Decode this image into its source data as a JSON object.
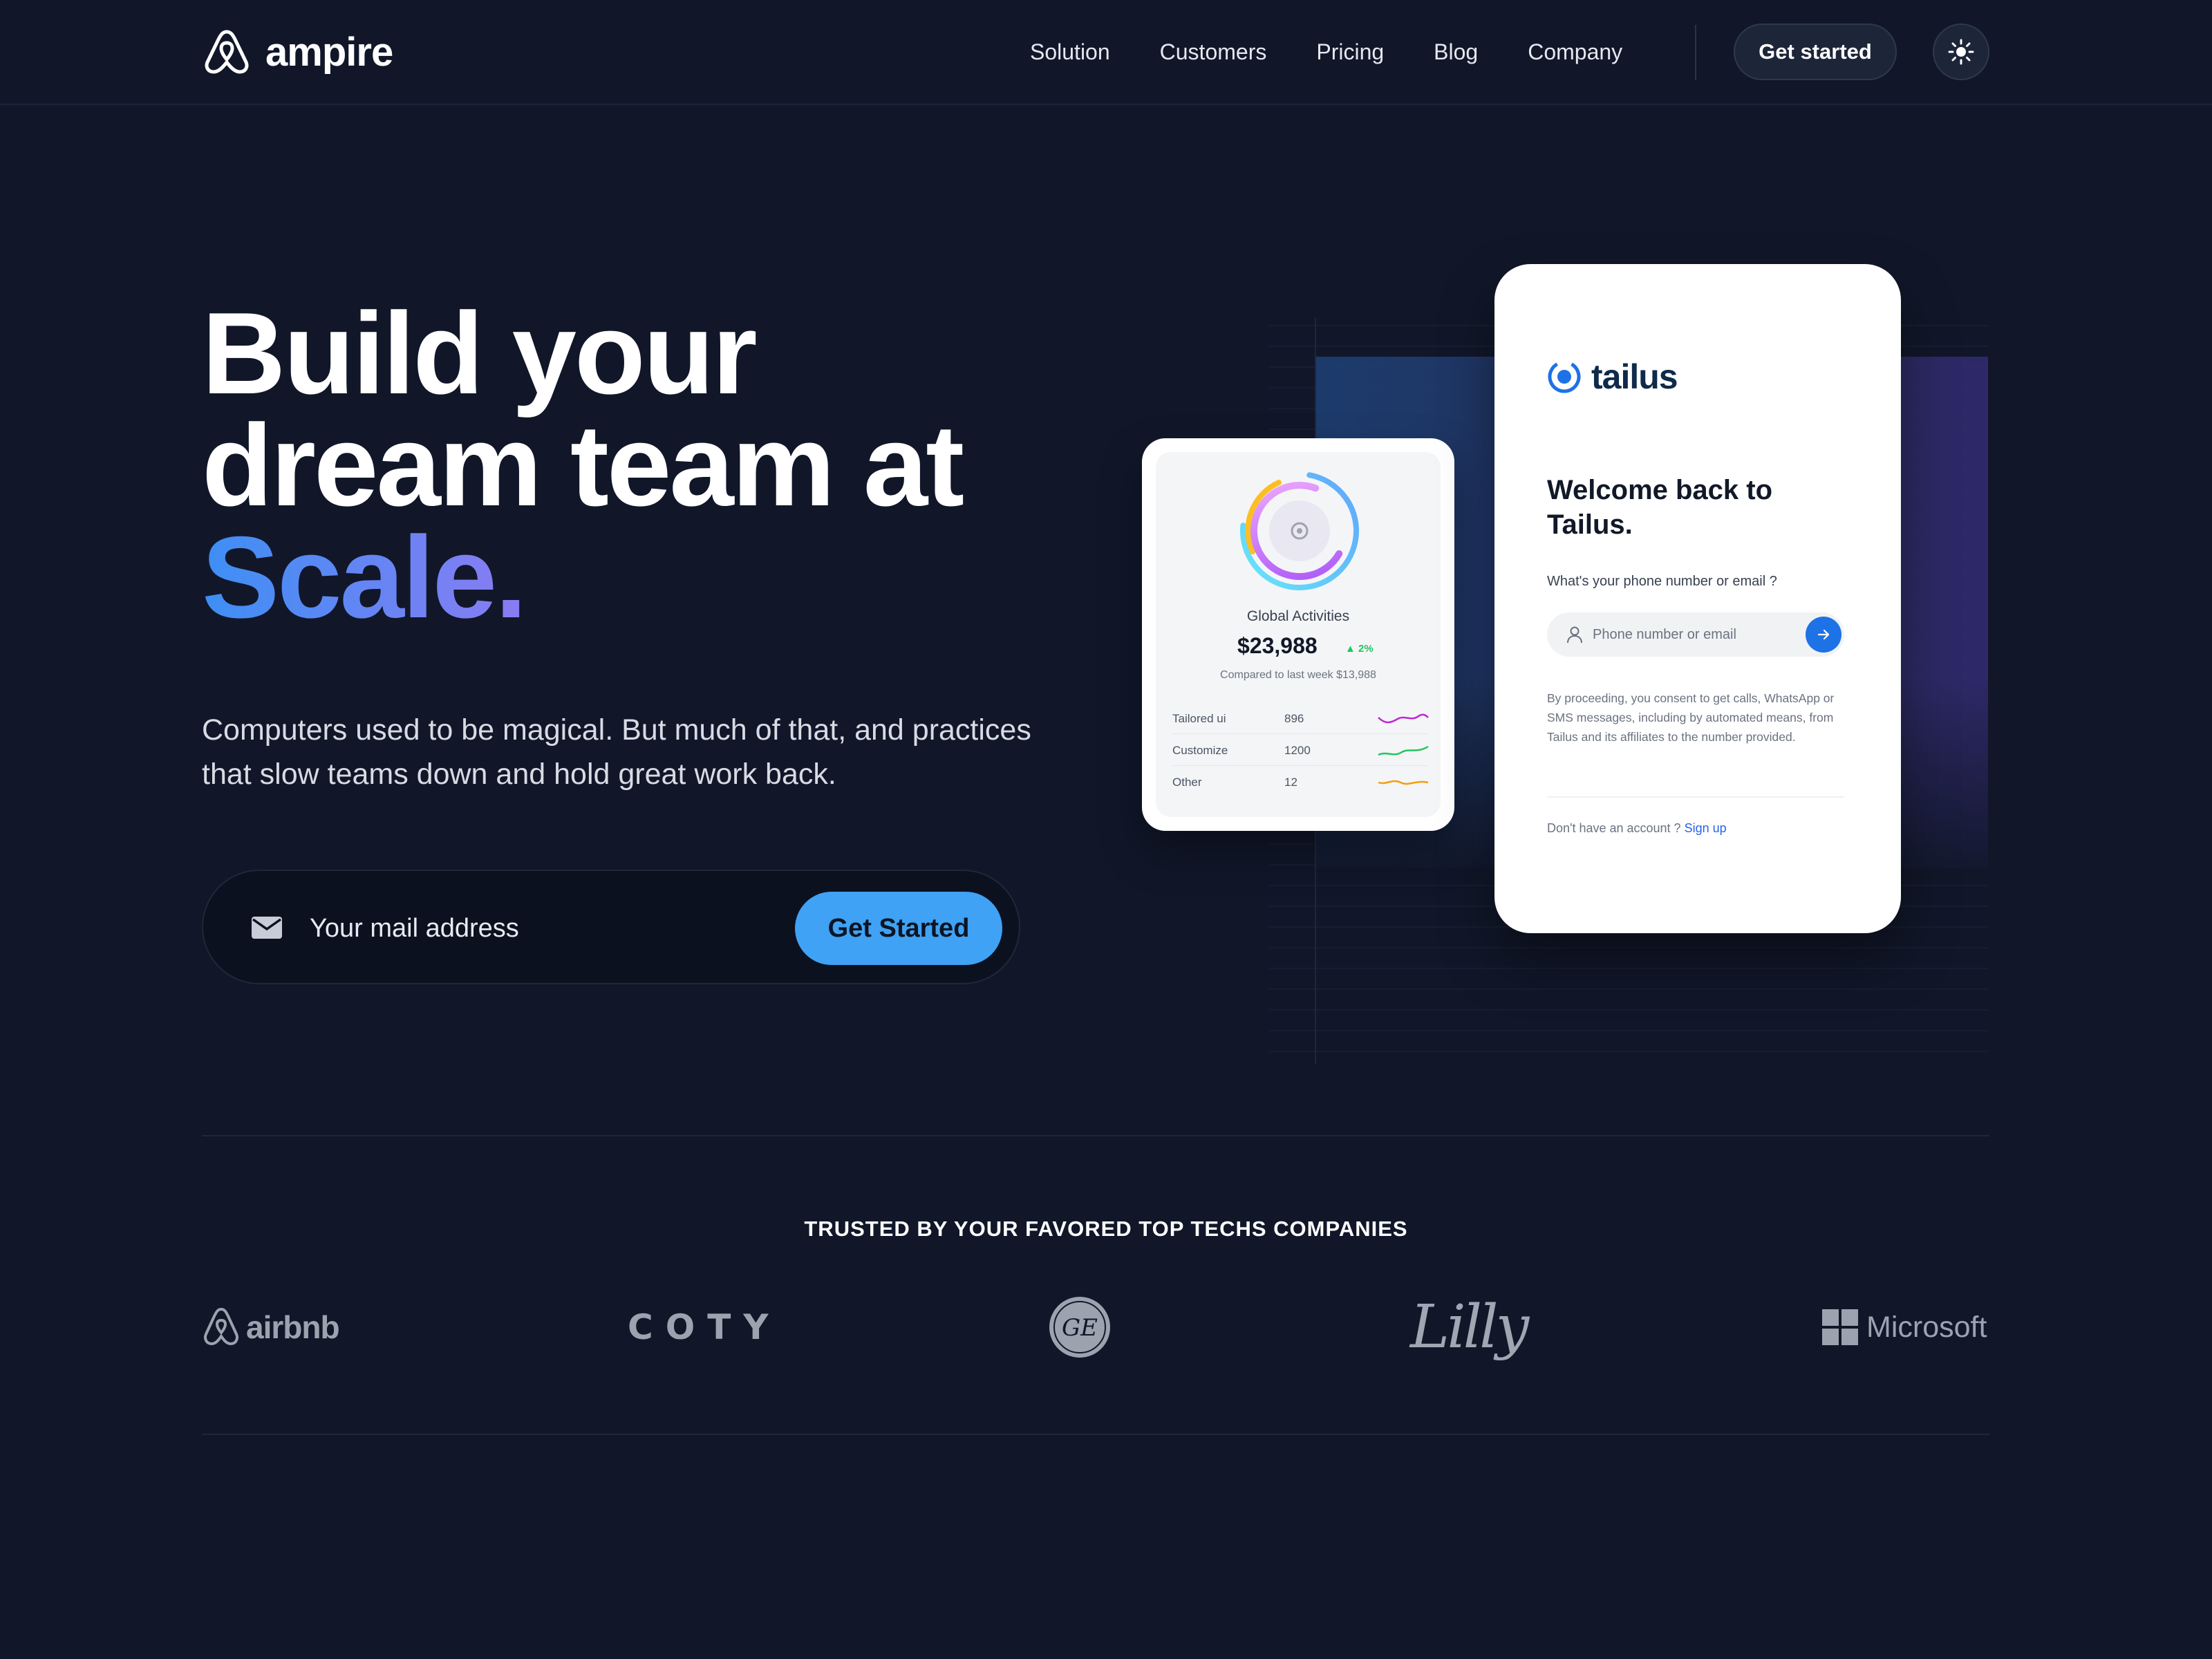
{
  "nav": {
    "brand": "ampire",
    "links": [
      "Solution",
      "Customers",
      "Pricing",
      "Blog",
      "Company"
    ],
    "cta": "Get started"
  },
  "hero": {
    "headline_line1": "Build your",
    "headline_line2": "dream team at",
    "headline_highlight": "Scale.",
    "subtitle": "Computers used to be magical. But much of that, and practices that slow teams down and hold great work back.",
    "email_placeholder": "Your mail address",
    "submit": "Get Started"
  },
  "stats_card": {
    "title": "Global Activities",
    "amount": "$23,988",
    "change": "2%",
    "compare": "Compared to last week $13,988",
    "rows": [
      {
        "name": "Tailored ui",
        "value": "896",
        "color": "#c026d3"
      },
      {
        "name": "Customize",
        "value": "1200",
        "color": "#22c55e"
      },
      {
        "name": "Other",
        "value": "12",
        "color": "#f59e0b"
      }
    ]
  },
  "login_card": {
    "brand": "tailus",
    "welcome": "Welcome back to Tailus.",
    "question": "What's your phone number or email ?",
    "input_placeholder": "Phone number or email",
    "consent": "By proceeding, you consent to get calls, WhatsApp or SMS messages, including by automated means, from Tailus and its affiliates to the number provided.",
    "no_account": "Don't have an account ?",
    "signup": "Sign up"
  },
  "trusted": {
    "heading": "TRUSTED BY YOUR FAVORED TOP TECHS COMPANIES",
    "logos": [
      "airbnb",
      "COTY",
      "GE",
      "Lilly",
      "Microsoft"
    ]
  },
  "colors": {
    "background": "#111729",
    "accent_blue": "#3fa2f4",
    "gradient_start": "#3d8ff5",
    "gradient_end": "#8a7cf2"
  },
  "icons": [
    "ampire-logo-icon",
    "sun-icon",
    "mail-icon",
    "tailus-logo-icon",
    "user-icon",
    "arrow-right-icon",
    "airbnb-logo-icon",
    "ge-logo-icon",
    "microsoft-logo-icon"
  ]
}
